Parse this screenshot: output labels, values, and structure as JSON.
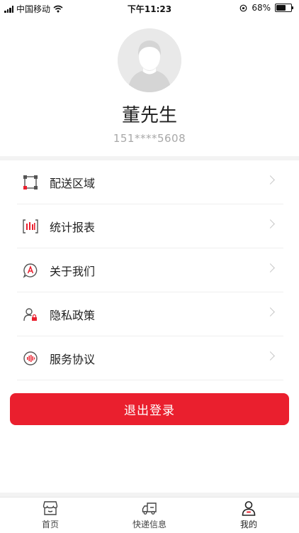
{
  "status_bar": {
    "carrier": "中国移动",
    "time": "下午11:23",
    "battery": "68%",
    "battery_level": 0.68
  },
  "profile": {
    "name": "董先生",
    "phone": "151****5608"
  },
  "menu": {
    "items": [
      {
        "label": "配送区域",
        "icon": "delivery-area-icon"
      },
      {
        "label": "统计报表",
        "icon": "statistics-report-icon"
      },
      {
        "label": "关于我们",
        "icon": "about-us-icon"
      },
      {
        "label": "隐私政策",
        "icon": "privacy-policy-icon"
      },
      {
        "label": "服务协议",
        "icon": "service-agreement-icon"
      }
    ]
  },
  "logout_label": "退出登录",
  "tabs": [
    {
      "label": "首页",
      "icon": "home-store-icon"
    },
    {
      "label": "快递信息",
      "icon": "truck-icon"
    },
    {
      "label": "我的",
      "icon": "profile-icon",
      "active": true
    }
  ],
  "colors": {
    "accent": "#ea1f2e",
    "icon_dark": "#555555"
  }
}
